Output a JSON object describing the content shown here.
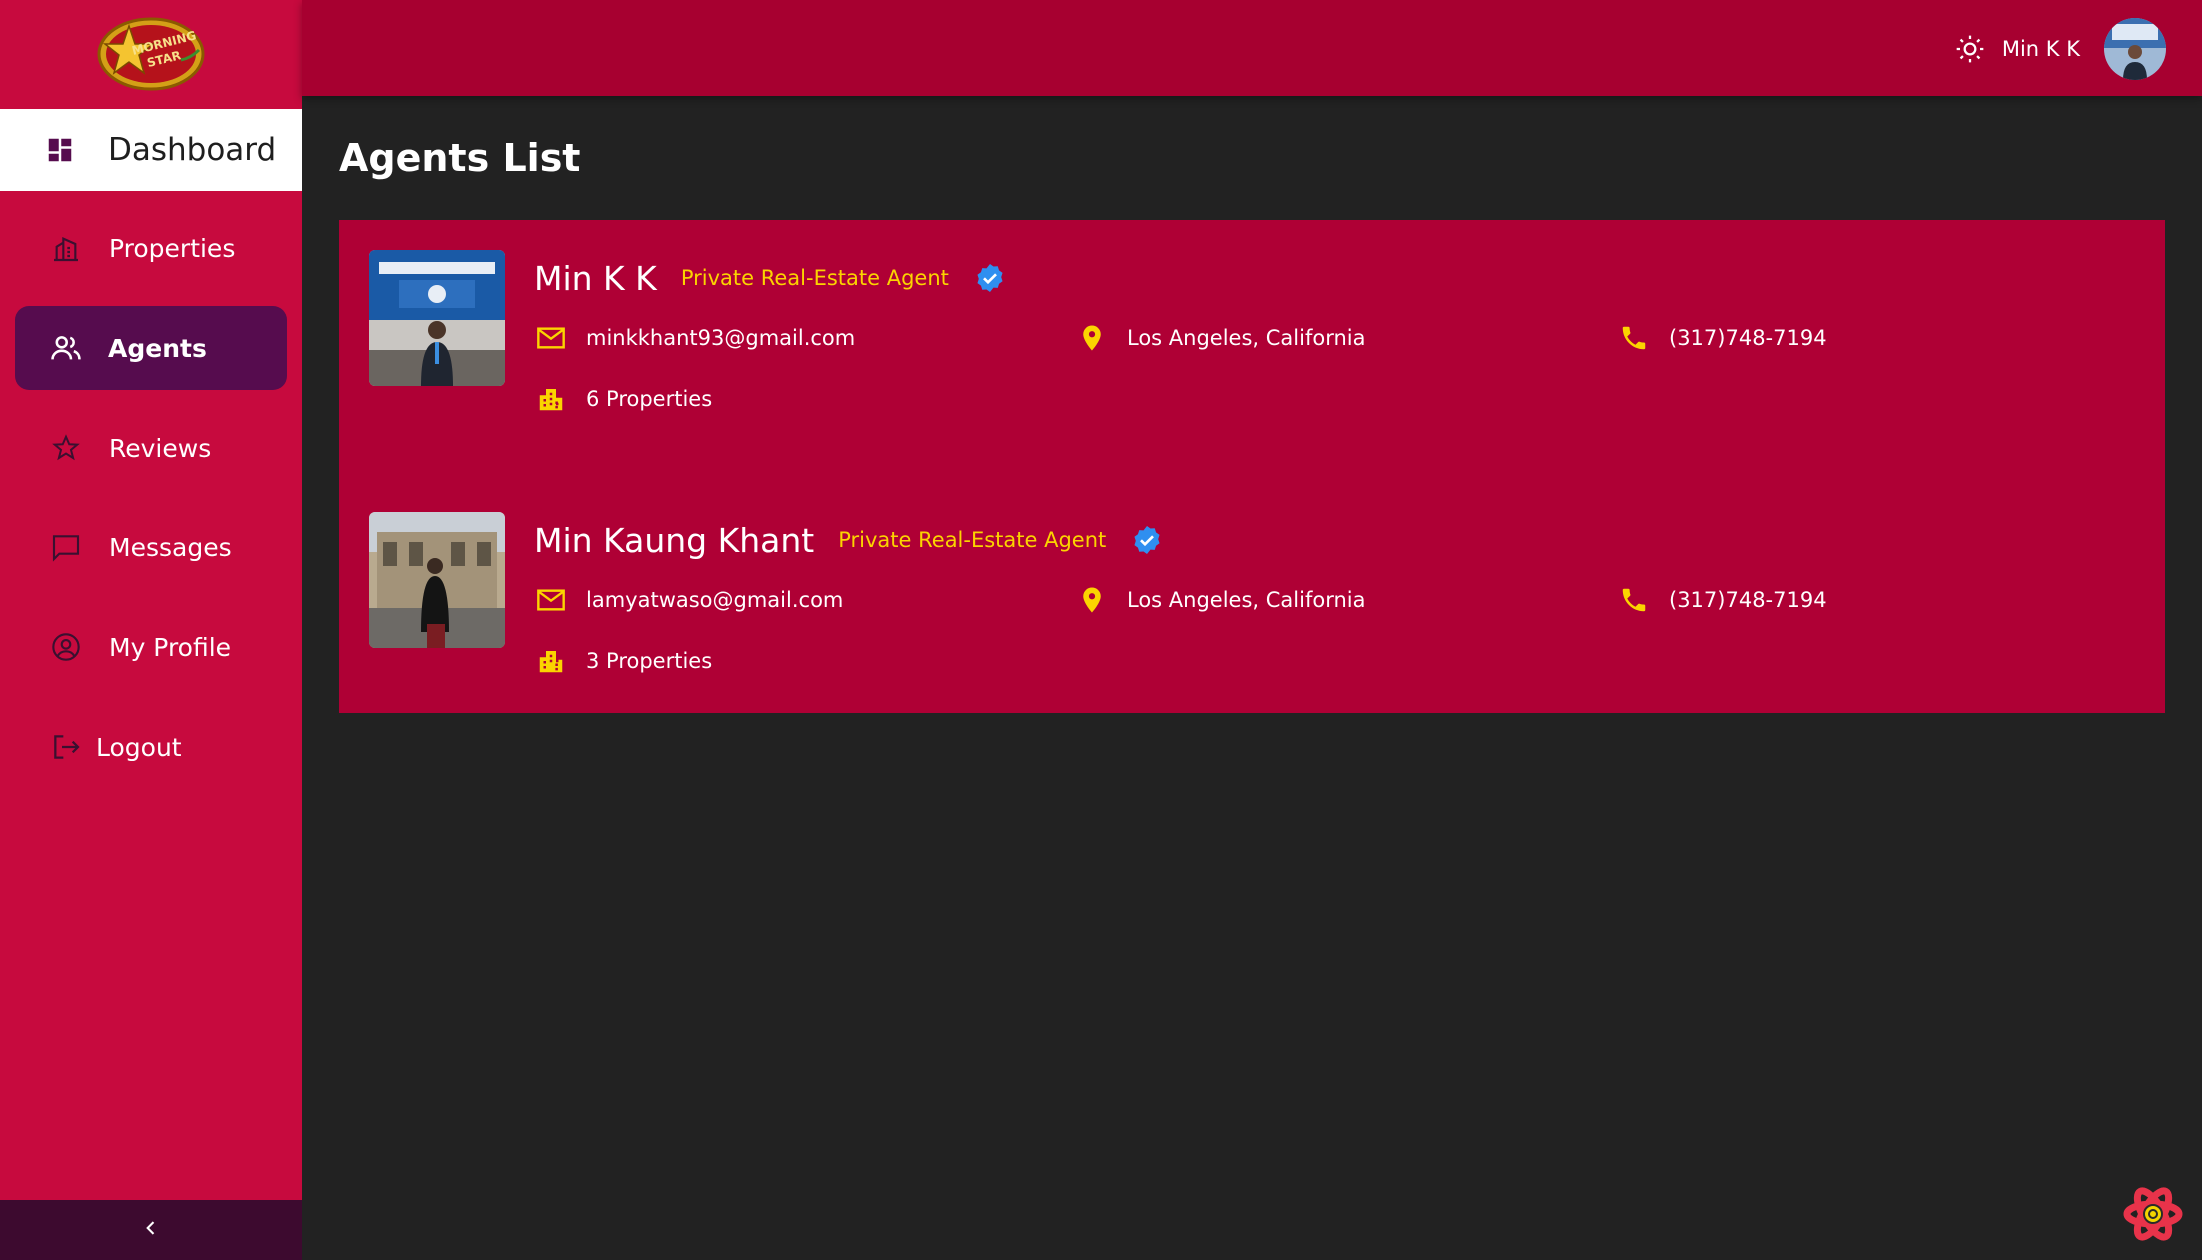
{
  "app": {
    "logo_text_line1": "MORNING",
    "logo_text_line2": "STAR"
  },
  "sidebar": {
    "items": [
      {
        "label": "Dashboard",
        "icon": "dashboard-icon"
      },
      {
        "label": "Properties",
        "icon": "building-icon"
      },
      {
        "label": "Agents",
        "icon": "people-icon"
      },
      {
        "label": "Reviews",
        "icon": "star-icon"
      },
      {
        "label": "Messages",
        "icon": "chat-icon"
      },
      {
        "label": "My Profile",
        "icon": "account-circle-icon"
      },
      {
        "label": "Logout",
        "icon": "logout-icon"
      }
    ],
    "active": "Agents",
    "collapse_icon": "chevron-left-icon"
  },
  "header": {
    "user_name": "Min K K",
    "theme_icon": "sun-icon"
  },
  "page": {
    "title": "Agents List"
  },
  "agents": [
    {
      "name": "Min K K",
      "role": "Private Real-Estate Agent",
      "email": "minkkhant93@gmail.com",
      "location": "Los Angeles, California",
      "phone": "(317)748-7194",
      "properties": "6 Properties",
      "verified": true
    },
    {
      "name": "Min Kaung Khant",
      "role": "Private Real-Estate Agent",
      "email": "lamyatwaso@gmail.com",
      "location": "Los Angeles, California",
      "phone": "(317)748-7194",
      "properties": "3 Properties",
      "verified": true
    }
  ],
  "colors": {
    "sidebar": "#c70a3e",
    "header": "#a70030",
    "active_nav": "#560c4e",
    "card": "#af0035",
    "accent": "#fbd400",
    "verified": "#2f8ff0",
    "background": "#222222"
  }
}
